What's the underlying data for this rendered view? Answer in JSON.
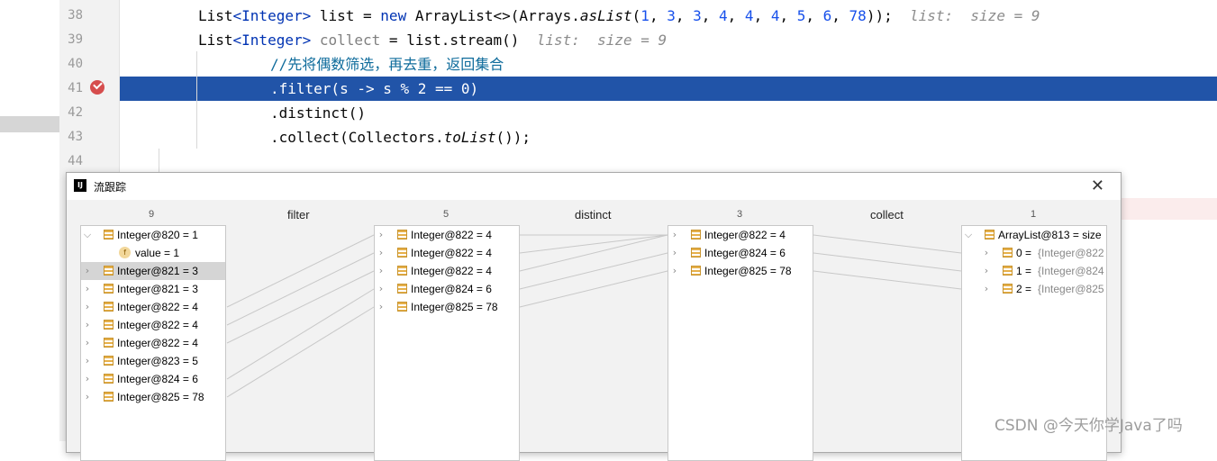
{
  "editor": {
    "line_numbers": [
      "38",
      "39",
      "40",
      "41",
      "42",
      "43",
      "44"
    ],
    "line38": {
      "a": "List",
      "b": "<Integer>",
      "c": " list = ",
      "d": "new",
      "e": " ArrayList<>(Arrays.",
      "f": "asList",
      "g": "(",
      "n1": "1",
      ", ": ", ",
      "n2": "3",
      "n3": "3",
      "n4": "4",
      "n5": "4",
      "n6": "4",
      "n7": "5",
      "n8": "6",
      "n9": "78",
      "end": "));",
      "hint": "list:  size = 9"
    },
    "line39": {
      "a": "List",
      "b": "<Integer>",
      "c": " collect",
      "d": " = list.stream()",
      "hint": "list:  size = 9"
    },
    "line40": "//先将偶数筛选，再去重，返回集合",
    "line41": ".filter(s -> s % 2 == 0)",
    "line42": ".distinct()",
    "line43a": ".collect(Collectors.",
    "line43b": "toList",
    "line43c": "());"
  },
  "dialog": {
    "title": "流跟踪",
    "close": "✕",
    "counts": [
      "9",
      "5",
      "3",
      "1"
    ],
    "ops": [
      "filter",
      "distinct",
      "collect"
    ],
    "col1": [
      {
        "text": "Integer@820 = 1",
        "expanded": true
      },
      {
        "text": "value = 1"
      },
      {
        "text": "Integer@821 = 3"
      },
      {
        "text": "Integer@821 = 3"
      },
      {
        "text": "Integer@822 = 4"
      },
      {
        "text": "Integer@822 = 4"
      },
      {
        "text": "Integer@822 = 4"
      },
      {
        "text": "Integer@823 = 5"
      },
      {
        "text": "Integer@824 = 6"
      },
      {
        "text": "Integer@825 = 78"
      }
    ],
    "col2": [
      "Integer@822 = 4",
      "Integer@822 = 4",
      "Integer@822 = 4",
      "Integer@824 = 6",
      "Integer@825 = 78"
    ],
    "col3": [
      "Integer@822 = 4",
      "Integer@824 = 6",
      "Integer@825 = 78"
    ],
    "col4": [
      {
        "text": "ArrayList@813 =  size"
      },
      {
        "idx": "0 = ",
        "val": "{Integer@822"
      },
      {
        "idx": "1 = ",
        "val": "{Integer@824"
      },
      {
        "idx": "2 = ",
        "val": "{Integer@825"
      }
    ]
  },
  "watermark": "CSDN @今天你学Java了吗"
}
